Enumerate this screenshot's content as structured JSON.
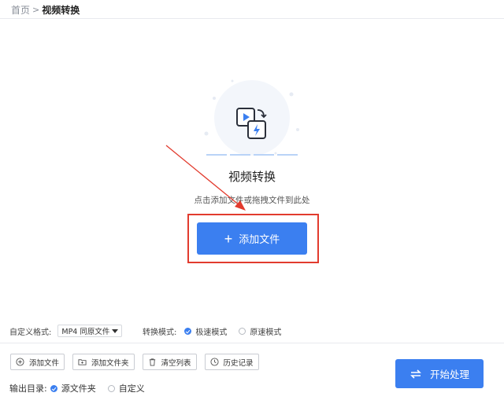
{
  "breadcrumb": {
    "home": "首页",
    "separator": ">",
    "current": "视频转换"
  },
  "drop_area": {
    "title": "视频转换",
    "hint": "点击添加文件或拖拽文件到此处",
    "add_button": "添加文件",
    "icon": "video-convert-icon"
  },
  "format": {
    "label": "自定义格式:",
    "selected": "MP4 同原文件"
  },
  "mode": {
    "label": "转换模式:",
    "options": [
      {
        "label": "极速模式",
        "selected": true
      },
      {
        "label": "原速模式",
        "selected": false
      }
    ]
  },
  "toolbar": {
    "add_file": "添加文件",
    "add_folder": "添加文件夹",
    "clear_list": "清空列表",
    "history": "历史记录"
  },
  "output": {
    "label": "输出目录:",
    "options": [
      {
        "label": "源文件夹",
        "selected": true
      },
      {
        "label": "自定义",
        "selected": false
      }
    ]
  },
  "start_button": "开始处理",
  "colors": {
    "accent": "#3b7ff0",
    "highlight": "#e23b2e"
  }
}
